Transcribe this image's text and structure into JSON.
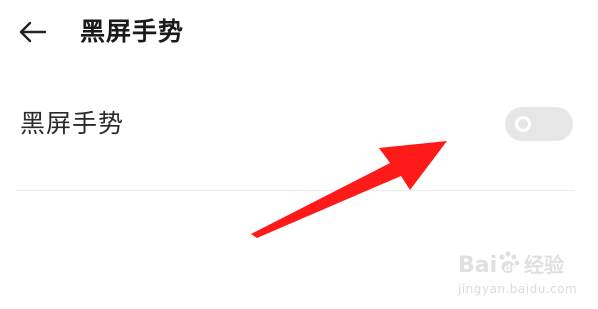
{
  "header": {
    "back_icon": "arrow-left-icon",
    "title": "黑屏手势"
  },
  "settings": {
    "rows": [
      {
        "label": "黑屏手势",
        "toggle_on": false
      }
    ]
  },
  "annotation": {
    "type": "arrow",
    "color": "#ff1a1a"
  },
  "watermark": {
    "logo_text": "Baidu经验",
    "url": "jingyan.baidu.com"
  },
  "colors": {
    "background": "#ffffff",
    "toggle_off_track": "#e6e6e6",
    "toggle_knob": "#ffffff",
    "divider": "#ececec",
    "arrow": "#ff1a1a"
  }
}
